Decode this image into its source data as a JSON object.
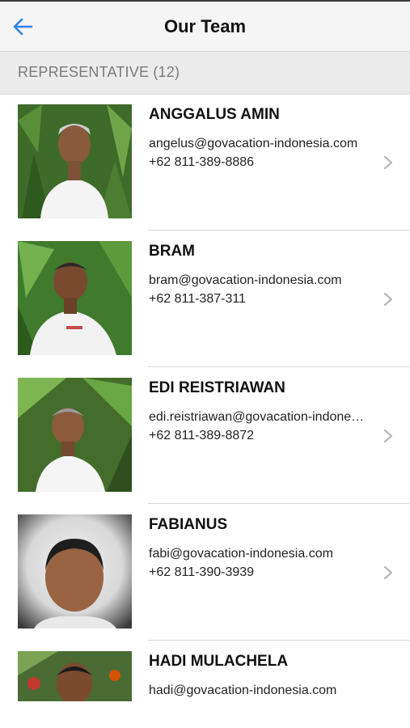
{
  "header": {
    "title": "Our Team",
    "back_icon": "arrow-left-icon",
    "accent": "#2f80ed"
  },
  "section": {
    "label": "REPRESENTATIVE (12)"
  },
  "members": [
    {
      "name": "ANGGALUS AMIN",
      "email": "angelus@govacation-indonesia.com",
      "phone": "+62 811-389-8886"
    },
    {
      "name": "BRAM",
      "email": "bram@govacation-indonesia.com",
      "phone": "+62 811-387-311"
    },
    {
      "name": "EDI REISTRIAWAN",
      "email": "edi.reistriawan@govacation-indonesia.com",
      "phone": "+62 811-389-8872"
    },
    {
      "name": "FABIANUS",
      "email": "fabi@govacation-indonesia.com",
      "phone": "+62 811-390-3939"
    },
    {
      "name": "HADI MULACHELA",
      "email": "hadi@govacation-indonesia.com",
      "phone": ""
    }
  ]
}
